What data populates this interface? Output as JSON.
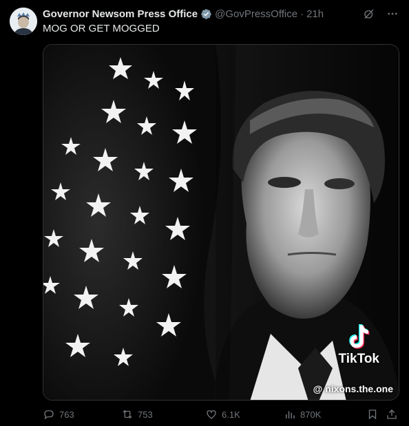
{
  "author": {
    "display_name": "Governor Newsom Press Office",
    "handle": "@GovPressOffice",
    "separator": "·",
    "time": "21h",
    "verified_color": "#829aab"
  },
  "tweet": {
    "text": "MOG OR GET MOGGED"
  },
  "media": {
    "tiktok_label": "TikTok",
    "tiktok_user": "@ nixons.the.one"
  },
  "actions": {
    "replies": "763",
    "reposts": "753",
    "likes": "6.1K",
    "views": "870K"
  },
  "icons": [
    "avatar",
    "verified-badge-icon",
    "grok-icon",
    "more-icon",
    "reply-icon",
    "repost-icon",
    "like-icon",
    "views-icon",
    "bookmark-icon",
    "share-icon",
    "tiktok-icon"
  ]
}
